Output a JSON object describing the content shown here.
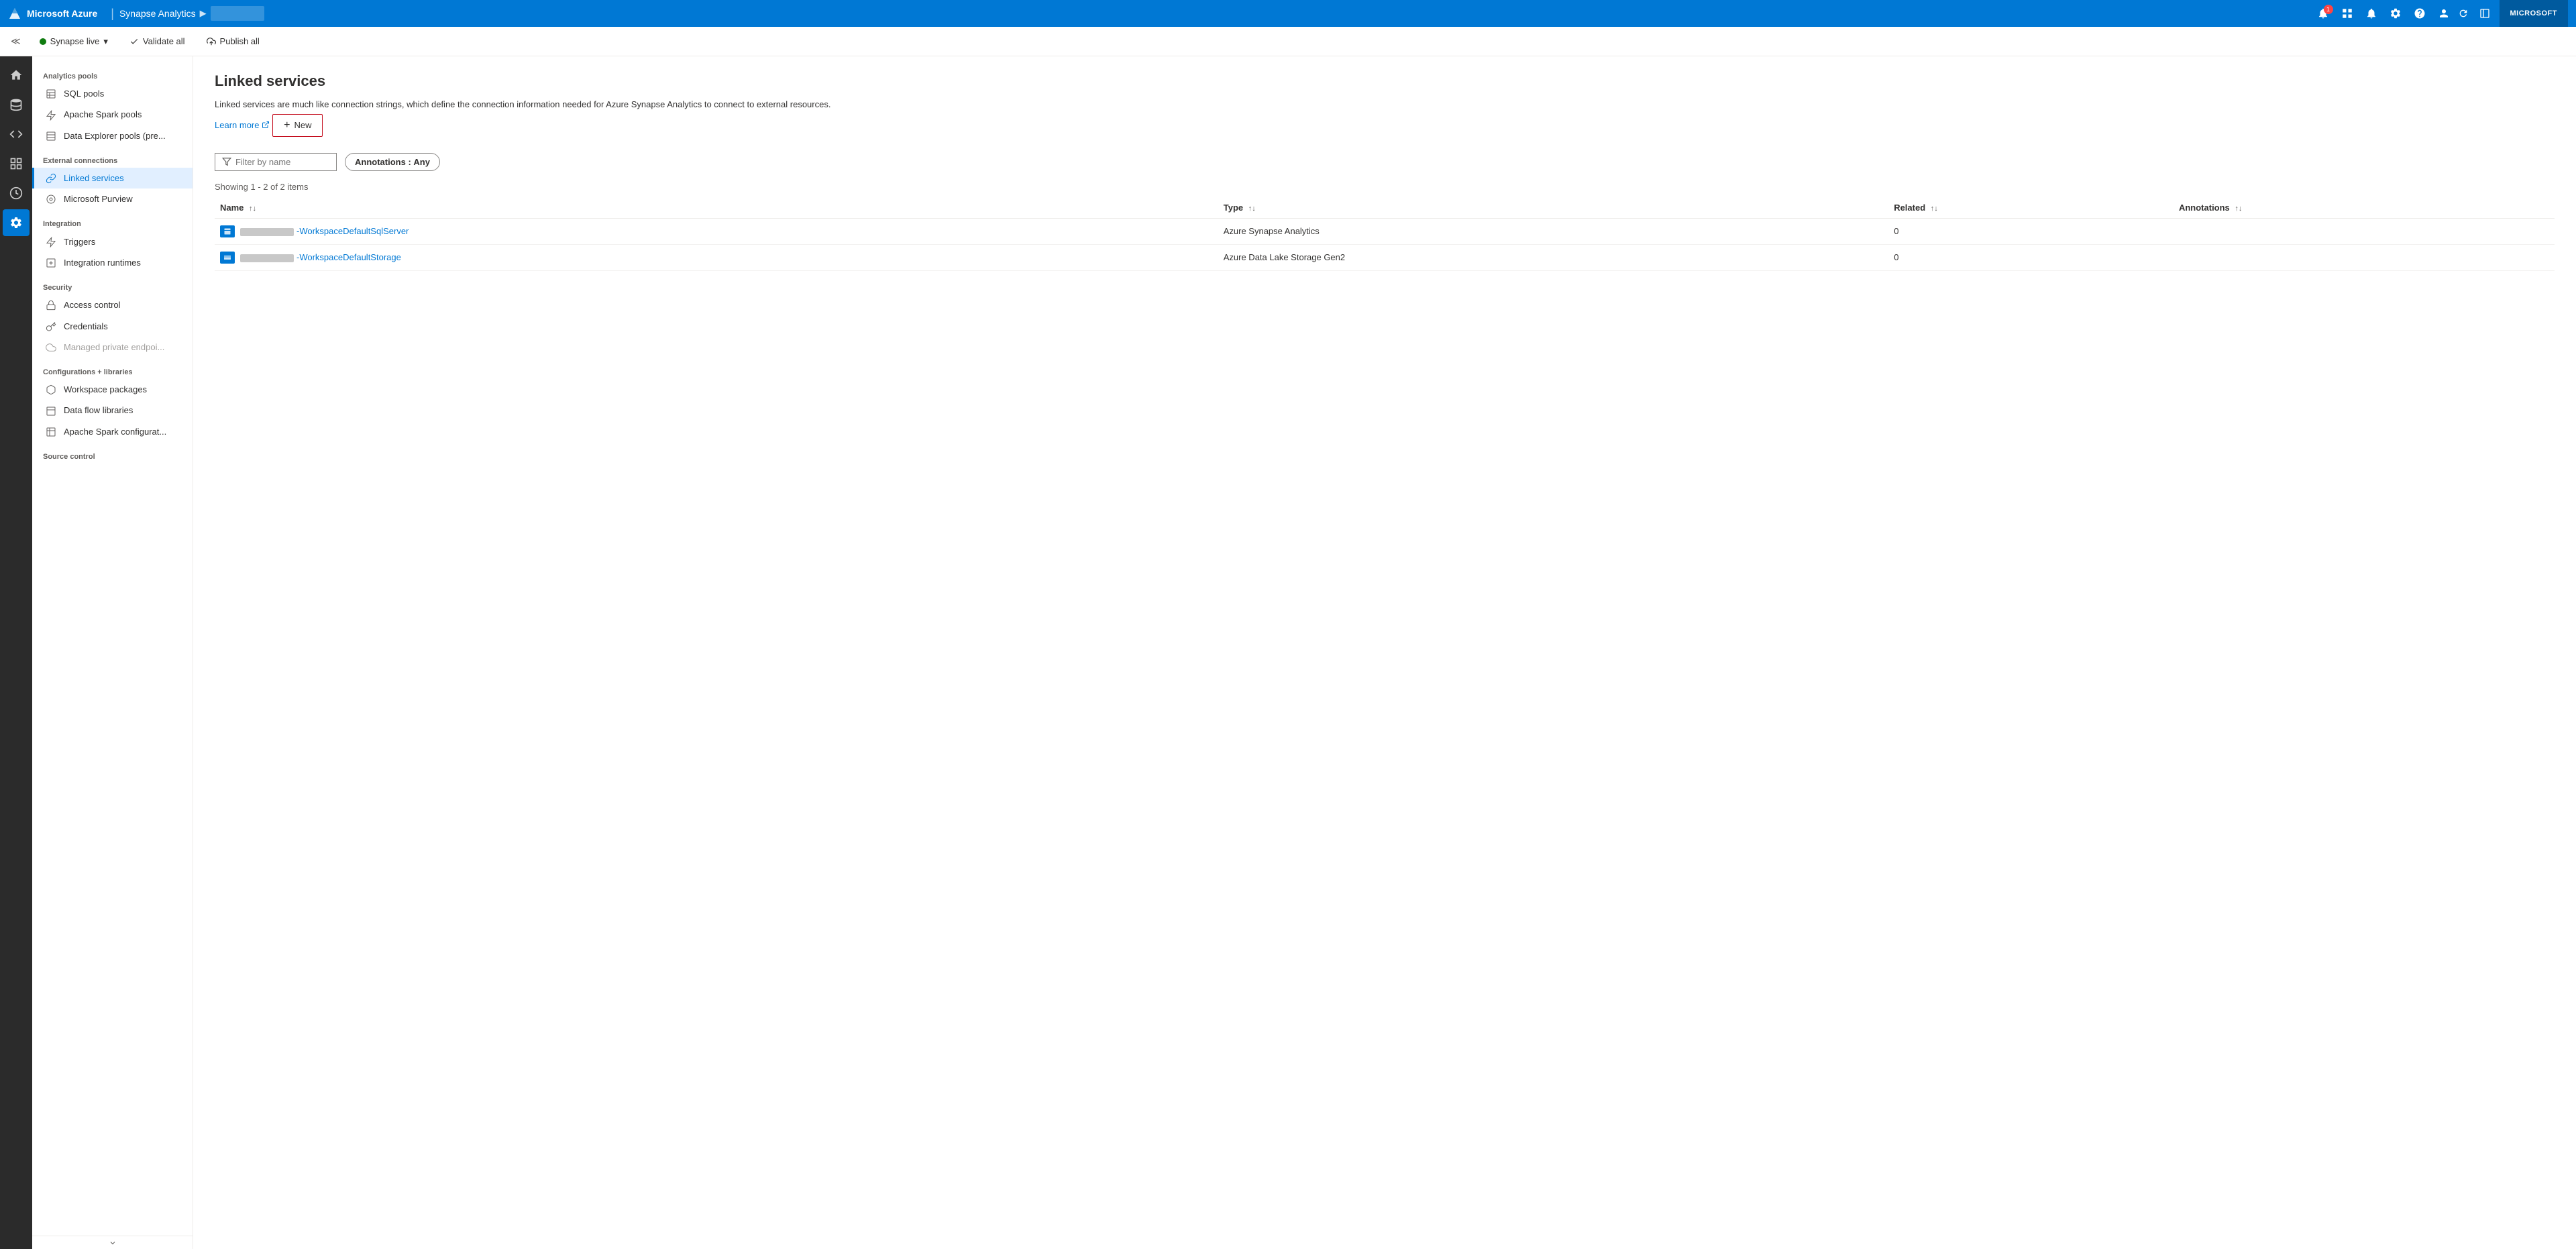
{
  "topBar": {
    "appName": "Microsoft Azure",
    "separator": "|",
    "productName": "Synapse Analytics",
    "arrow": "▶",
    "workspacePlaceholder": "",
    "userLabel": "MICROSOFT",
    "icons": {
      "notification": "🔔",
      "grid": "⊞",
      "bell": "🔔",
      "settings": "⚙",
      "help": "?",
      "user": "👤",
      "refresh": "↻",
      "layout": "⊟"
    },
    "notificationCount": "1"
  },
  "secondBar": {
    "collapseIcon": "≪",
    "synapseLive": "Synapse live",
    "chevronDown": "▾",
    "validateAll": "Validate all",
    "publishAll": "Publish all"
  },
  "iconSidebar": {
    "items": [
      {
        "id": "home",
        "icon": "⌂",
        "active": false
      },
      {
        "id": "data",
        "icon": "▭",
        "active": false
      },
      {
        "id": "develop",
        "icon": "☰",
        "active": false
      },
      {
        "id": "integrate",
        "icon": "⊕",
        "active": false
      },
      {
        "id": "monitor",
        "icon": "◎",
        "active": false
      },
      {
        "id": "manage",
        "icon": "🔧",
        "active": true
      }
    ]
  },
  "navSidebar": {
    "sections": [
      {
        "header": "Analytics pools",
        "items": [
          {
            "id": "sql-pools",
            "label": "SQL pools",
            "icon": "▦",
            "active": false
          },
          {
            "id": "apache-spark",
            "label": "Apache Spark pools",
            "icon": "⚡",
            "active": false
          },
          {
            "id": "data-explorer",
            "label": "Data Explorer pools (pre...",
            "icon": "▦",
            "active": false
          }
        ]
      },
      {
        "header": "External connections",
        "items": [
          {
            "id": "linked-services",
            "label": "Linked services",
            "icon": "🔗",
            "active": true
          },
          {
            "id": "microsoft-purview",
            "label": "Microsoft Purview",
            "icon": "◎",
            "active": false
          }
        ]
      },
      {
        "header": "Integration",
        "items": [
          {
            "id": "triggers",
            "label": "Triggers",
            "icon": "⚡",
            "active": false
          },
          {
            "id": "integration-runtimes",
            "label": "Integration runtimes",
            "icon": "▦",
            "active": false
          }
        ]
      },
      {
        "header": "Security",
        "items": [
          {
            "id": "access-control",
            "label": "Access control",
            "icon": "▦",
            "active": false
          },
          {
            "id": "credentials",
            "label": "Credentials",
            "icon": "◎",
            "active": false
          },
          {
            "id": "managed-private",
            "label": "Managed private endpoi...",
            "icon": "☁",
            "active": false,
            "disabled": true
          }
        ]
      },
      {
        "header": "Configurations + libraries",
        "items": [
          {
            "id": "workspace-packages",
            "label": "Workspace packages",
            "icon": "▦",
            "active": false
          },
          {
            "id": "data-flow-libraries",
            "label": "Data flow libraries",
            "icon": "▦",
            "active": false
          },
          {
            "id": "apache-spark-config",
            "label": "Apache Spark configurat...",
            "icon": "▦",
            "active": false
          }
        ]
      },
      {
        "header": "Source control",
        "items": []
      }
    ]
  },
  "mainContent": {
    "pageTitle": "Linked services",
    "description": "Linked services are much like connection strings, which define the connection information needed for Azure Synapse Analytics to connect to external resources.",
    "learnMore": "Learn more",
    "newButton": "New",
    "filterPlaceholder": "Filter by name",
    "annotationsLabel": "Annotations",
    "annotationsColon": ":",
    "annotationsValue": "Any",
    "showingText": "Showing 1 - 2 of 2 items",
    "table": {
      "columns": [
        {
          "id": "name",
          "label": "Name",
          "sortable": true
        },
        {
          "id": "type",
          "label": "Type",
          "sortable": true
        },
        {
          "id": "related",
          "label": "Related",
          "sortable": true
        },
        {
          "id": "annotations",
          "label": "Annotations",
          "sortable": true
        }
      ],
      "rows": [
        {
          "id": "row1",
          "namePrefix": "",
          "nameSuffix": "-WorkspaceDefaultSqlServer",
          "type": "Azure Synapse Analytics",
          "related": "0",
          "annotations": "",
          "iconType": "sql"
        },
        {
          "id": "row2",
          "namePrefix": "",
          "nameSuffix": "-WorkspaceDefaultStorage",
          "type": "Azure Data Lake Storage Gen2",
          "related": "0",
          "annotations": "",
          "iconType": "storage"
        }
      ]
    }
  }
}
